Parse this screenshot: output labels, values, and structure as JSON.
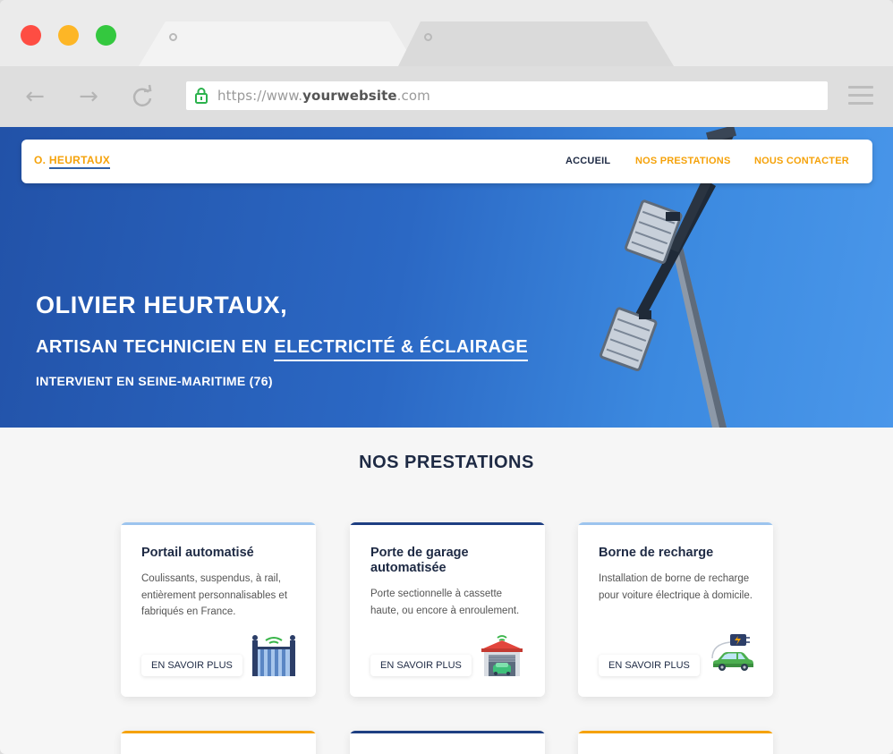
{
  "browser": {
    "url_prefix": "https://www.",
    "url_domain": "yourwebsite",
    "url_suffix": ".com",
    "icons": {
      "back": "arrow-left-icon",
      "forward": "arrow-right-icon",
      "reload": "reload-icon",
      "secure": "lock-icon",
      "menu": "hamburger-menu-icon"
    }
  },
  "site": {
    "logo_first": "O.",
    "logo_second": "HEURTAUX",
    "nav": {
      "home": "ACCUEIL",
      "services": "NOS PRESTATIONS",
      "contact": "NOUS CONTACTER"
    }
  },
  "hero": {
    "title": "OLIVIER HEURTAUX,",
    "subtitle_prefix": "ARTISAN TECHNICIEN EN",
    "subtitle_highlight": "ELECTRICITÉ & ÉCLAIRAGE",
    "area": "INTERVIENT EN SEINE-MARITIME (76)"
  },
  "services": {
    "title": "NOS PRESTATIONS",
    "cards": [
      {
        "title": "Portail automatisé",
        "description": "Coulissants, suspendus, à rail, entièrement personnalisables et fabriqués en France.",
        "button": "EN SAVOIR PLUS",
        "icon": "automatic-gate-icon",
        "accent": "#9cc4ee"
      },
      {
        "title": "Porte de garage automatisée",
        "description": "Porte sectionnelle à cassette haute, ou encore à enroulement.",
        "button": "EN SAVOIR PLUS",
        "icon": "garage-icon",
        "accent": "#1e3f82"
      },
      {
        "title": "Borne de recharge",
        "description": "Installation de borne de recharge pour voiture électrique à domicile.",
        "button": "EN SAVOIR PLUS",
        "icon": "ev-charging-icon",
        "accent": "#9cc4ee"
      }
    ]
  },
  "colors": {
    "orange": "#f5a20a",
    "navy": "#1e2a44",
    "hero_blue": "#2b68c4"
  }
}
